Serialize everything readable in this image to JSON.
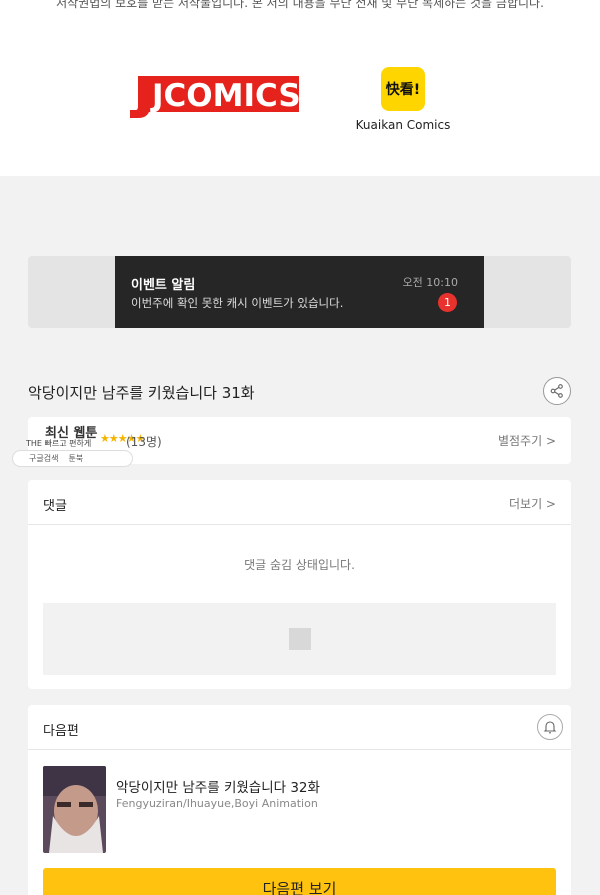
{
  "footer": {
    "copyright_notice": "저작권법의 보호를 받는 저작물입니다. 본 저의 내용을 무단 전재 및 무단 복제하는 것을 금합니다.",
    "partners": [
      {
        "name": "JCOMICS",
        "icon": "jcomics-logo"
      },
      {
        "logo_text": "快看!",
        "name": "Kuaikan Comics",
        "icon": "kuaikan-logo"
      }
    ]
  },
  "banner": {
    "title": "이벤트 알림",
    "message": "이번주에 확인 못한 캐시 이벤트가 있습니다.",
    "time": "오전 10:10",
    "badge_count": "1"
  },
  "episode": {
    "title": "악당이지만 남주를 키웠습니다 31화",
    "share_icon": "share-icon"
  },
  "rating": {
    "label": "최신 웹툰",
    "stars": "★★★★★",
    "count": "(13명)",
    "rate_button": "별점주기 >"
  },
  "overlay": {
    "small_text": "THE 빠르고 편하게",
    "search_label": "구글검색",
    "book_label": "툰북"
  },
  "comments": {
    "title": "댓글",
    "more": "더보기 >",
    "hidden_message": "댓글 숨김 상태입니다."
  },
  "next": {
    "section_title": "다음편",
    "bell_icon": "bell-icon",
    "title": "악당이지만 남주를 키웠습니다 32화",
    "author": "Fengyuziran/Ihuayue,Boyi Animation",
    "button": "다음편 보기"
  },
  "colors": {
    "accent_yellow": "#ffc20e",
    "jcomics_red": "#e5231c",
    "badge_red": "#e8322e",
    "banner_dark": "#262626"
  }
}
